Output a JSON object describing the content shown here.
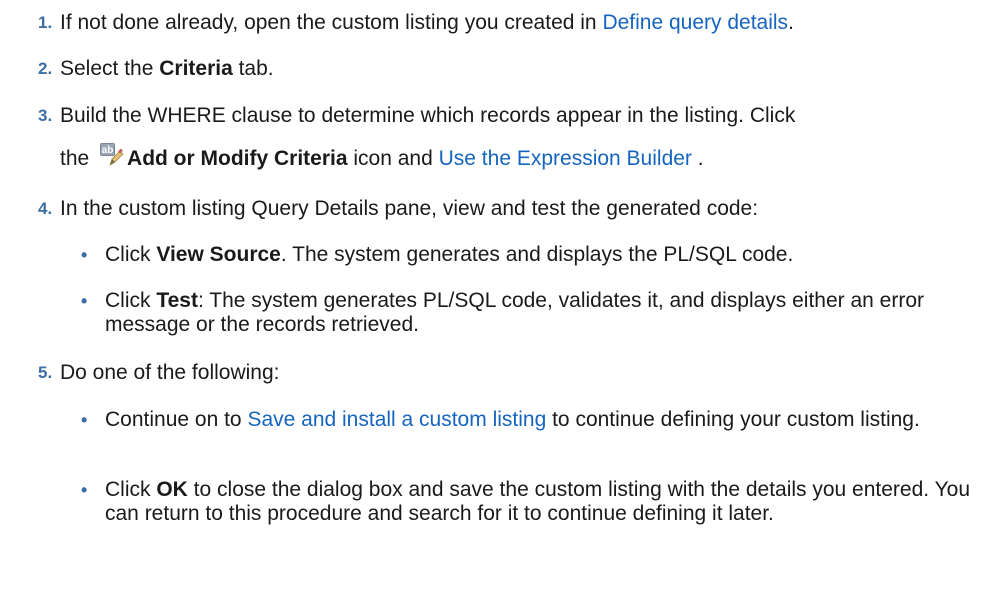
{
  "steps": [
    {
      "number": "1.",
      "prefix": "If not done already, open the custom listing you created in ",
      "link": "Define query details",
      "suffix": "."
    },
    {
      "number": "2.",
      "prefix": "Select the ",
      "bold": "Criteria",
      "suffix": " tab."
    },
    {
      "number": "3.",
      "line1": "Build the WHERE clause to determine which records appear in the listing. Click",
      "line2_prefix": "the ",
      "icon": "add-modify-criteria-icon",
      "bold": "Add or Modify Criteria",
      "middle": " icon and ",
      "link": "Use the Expression Builder",
      "suffix": " ."
    },
    {
      "number": "4.",
      "text": "In the custom listing Query Details pane, view and test the generated code:",
      "bullets": [
        {
          "prefix": "Click ",
          "bold": "View Source",
          "suffix": ". The system generates and displays the PL/SQL code."
        },
        {
          "prefix": "Click ",
          "bold": "Test",
          "suffix": ": The system generates PL/SQL code, validates it, and displays either an error message or the records retrieved."
        }
      ]
    },
    {
      "number": "5.",
      "text": "Do one of the following:",
      "bullets": [
        {
          "prefix": "Continue on to ",
          "link": "Save and install a custom listing",
          "suffix": " to continue defining your custom listing."
        },
        {
          "prefix": "Click ",
          "bold": "OK",
          "suffix": " to close the dialog box and save the custom listing with the details you entered. You can return to this procedure and search for it to continue defining it later."
        }
      ]
    }
  ],
  "bullet_glyph": "•",
  "colors": {
    "text": "#1a1a1a",
    "link": "#1565c0",
    "number": "#3a6ea5"
  }
}
